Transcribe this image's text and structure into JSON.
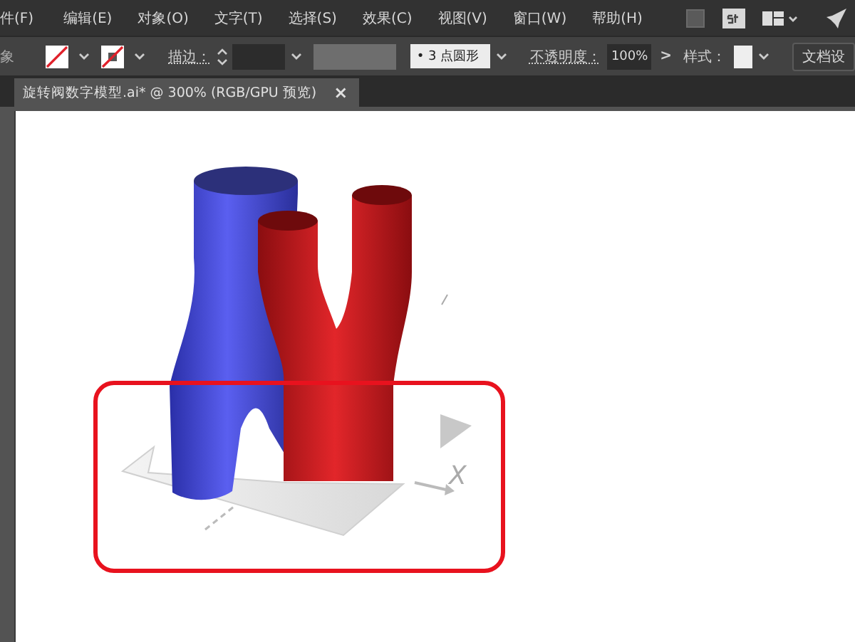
{
  "menu": [
    "件(F)",
    "编辑(E)",
    "对象(O)",
    "文字(T)",
    "选择(S)",
    "效果(C)",
    "视图(V)",
    "窗口(W)",
    "帮助(H)"
  ],
  "control_bar": {
    "object_label": "象",
    "stroke_label": "描边：",
    "brush": "• 3 点圆形",
    "opacity_label": "不透明度：",
    "opacity": "100%",
    "opacity_arrow": ">",
    "style_label": "样式：",
    "doc_button": "文档设"
  },
  "document_tab": {
    "title": "旋转阀数字模型.ai* @ 300% (RGB/GPU 预览)",
    "close": "×",
    "selected": true
  },
  "artwork": {
    "axis_label": "X"
  }
}
